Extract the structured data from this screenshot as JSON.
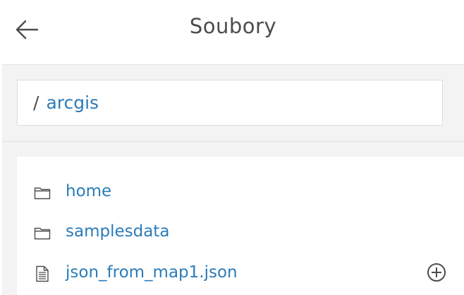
{
  "header": {
    "title": "Soubory",
    "back_icon": "arrow-left-icon"
  },
  "breadcrumb": {
    "separator": "/",
    "current": "arcgis"
  },
  "files": [
    {
      "name": "home",
      "type": "folder",
      "icon": "folder-icon"
    },
    {
      "name": "samplesdata",
      "type": "folder",
      "icon": "folder-icon"
    },
    {
      "name": "json_from_map1.json",
      "type": "file",
      "icon": "document-icon",
      "action_icon": "plus-circle-icon"
    }
  ],
  "colors": {
    "link": "#2b7cb9",
    "text": "#4c4c4c",
    "background": "#f3f3f3"
  }
}
